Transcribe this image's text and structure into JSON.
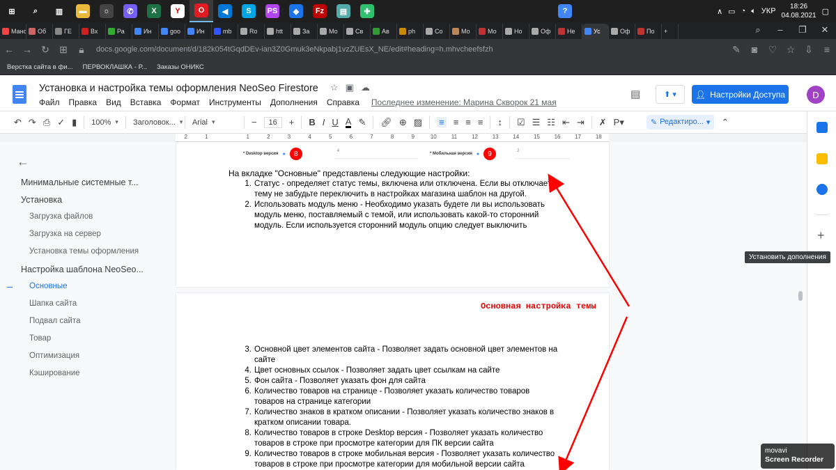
{
  "taskbar": {
    "apps": [
      {
        "name": "windows-start-icon",
        "label": "⊞",
        "color": "#1f1f1f"
      },
      {
        "name": "search-icon",
        "label": "⌕",
        "color": "#1f1f1f"
      },
      {
        "name": "task-view-icon",
        "label": "▥",
        "color": "#1f1f1f"
      },
      {
        "name": "file-explorer-icon",
        "label": "▬",
        "color": "#e8b93a"
      },
      {
        "name": "app-icon",
        "label": "☼",
        "color": "#444"
      },
      {
        "name": "viber-icon",
        "label": "✆",
        "color": "#7360f2"
      },
      {
        "name": "excel-icon",
        "label": "X",
        "color": "#1e7145"
      },
      {
        "name": "yandex-browser-icon",
        "label": "Y",
        "color": "#fff"
      },
      {
        "name": "opera-icon",
        "label": "O",
        "color": "#e01b22"
      },
      {
        "name": "vscode-icon",
        "label": "◀",
        "color": "#0078d7"
      },
      {
        "name": "skype-icon",
        "label": "S",
        "color": "#00a5e4"
      },
      {
        "name": "phpstorm-icon",
        "label": "PS",
        "color": "#b345f1"
      },
      {
        "name": "maps-icon",
        "label": "◆",
        "color": "#1a73e8"
      },
      {
        "name": "filezilla-icon",
        "label": "Fz",
        "color": "#bf0000"
      },
      {
        "name": "notes-icon",
        "label": "▤",
        "color": "#5aa"
      },
      {
        "name": "teamviewer-icon",
        "label": "✚",
        "color": "#2fbf6f"
      },
      {
        "name": "chrome-icon",
        "label": "?",
        "color": "#4285f4"
      }
    ],
    "language": "УКР",
    "time": "18:26",
    "date": "04.08.2021"
  },
  "tabs": [
    {
      "label": "Мано",
      "color": "#e44"
    },
    {
      "label": "Об",
      "color": "#c66"
    },
    {
      "label": "ГЕ",
      "color": "#888"
    },
    {
      "label": "Вх",
      "color": "#c22"
    },
    {
      "label": "Ра",
      "color": "#3a3"
    },
    {
      "label": "Ин",
      "color": "#4285f4"
    },
    {
      "label": "goo",
      "color": "#4285f4"
    },
    {
      "label": "Ин",
      "color": "#4285f4"
    },
    {
      "label": "mb",
      "color": "#35f"
    },
    {
      "label": "Ro",
      "color": "#aaa"
    },
    {
      "label": "htt",
      "color": "#aaa"
    },
    {
      "label": "За",
      "color": "#aaa"
    },
    {
      "label": "Мо",
      "color": "#aaa"
    },
    {
      "label": "Св",
      "color": "#aaa"
    },
    {
      "label": "Ав",
      "color": "#393"
    },
    {
      "label": "ph",
      "color": "#c80"
    },
    {
      "label": "Co",
      "color": "#aaa"
    },
    {
      "label": "Мо",
      "color": "#b85"
    },
    {
      "label": "Мо",
      "color": "#b33"
    },
    {
      "label": "Но",
      "color": "#aaa"
    },
    {
      "label": "Оф",
      "color": "#aaa"
    },
    {
      "label": "Не",
      "color": "#b33"
    },
    {
      "label": "Ус",
      "color": "#4285f4"
    },
    {
      "label": "Оф",
      "color": "#aaa"
    },
    {
      "label": "По",
      "color": "#b33"
    }
  ],
  "active_tab_index": 22,
  "address": {
    "url": "docs.google.com/document/d/182k054tGqdDEv-ian3Z0Gmuk3eNkpabj1vzZUEsX_NE/edit#heading=h.mhvcheefsfzh"
  },
  "bookmarks": [
    "Верстка сайта в фи...",
    "ПЕРВОКЛАШКА - Р...",
    "Заказы ОНИКС"
  ],
  "doc": {
    "title": "Установка и настройка темы оформления NeoSeo Firestore",
    "menus": [
      "Файл",
      "Правка",
      "Вид",
      "Вставка",
      "Формат",
      "Инструменты",
      "Дополнения",
      "Справка"
    ],
    "last_edit": "Последнее изменение: Марина Скворок 21 мая",
    "share_label": "Настройки Доступа",
    "avatar_letter": "D"
  },
  "toolbar": {
    "zoom": "100%",
    "style": "Заголовок...",
    "font": "Arial",
    "font_size": "16",
    "edit_mode": "Редактиро..."
  },
  "ruler": [
    "2",
    "1",
    "",
    "1",
    "2",
    "3",
    "4",
    "5",
    "6",
    "7",
    "8",
    "9",
    "10",
    "11",
    "12",
    "13",
    "14",
    "15",
    "16",
    "17",
    "18"
  ],
  "outline": [
    {
      "label": "Минимальные системные т...",
      "level": 1,
      "selected": false
    },
    {
      "label": "Установка",
      "level": 1,
      "selected": false
    },
    {
      "label": "Загрузка файлов",
      "level": 2,
      "selected": false
    },
    {
      "label": "Загрузка на сервер",
      "level": 2,
      "selected": false
    },
    {
      "label": "Установка темы оформления",
      "level": 2,
      "selected": false
    },
    {
      "label": "Настройка шаблона NeoSeo...",
      "level": 1,
      "selected": false
    },
    {
      "label": "Основные",
      "level": 2,
      "selected": true
    },
    {
      "label": "Шапка сайта",
      "level": 2,
      "selected": false
    },
    {
      "label": "Подвал сайта",
      "level": 2,
      "selected": false
    },
    {
      "label": "Товар",
      "level": 2,
      "selected": false
    },
    {
      "label": "Оптимизация",
      "level": 2,
      "selected": false
    },
    {
      "label": "Кэширование",
      "level": 2,
      "selected": false
    }
  ],
  "page1": {
    "desktop_label": "* Desktop версия",
    "desktop_value": "4",
    "desktop_marker": "8",
    "mobile_label": "* Мобильная версия",
    "mobile_value": "2",
    "mobile_marker": "9",
    "intro": "На вкладке \"Основные\" представлены следующие настройки:",
    "items": [
      {
        "num": "1.",
        "lines": [
          "Статус - определяет статус темы, включена или отключена. Если вы отключаете",
          "тему не забудьте переключить в настройках магазина шаблон на другой."
        ]
      },
      {
        "num": "2.",
        "lines": [
          "Использовать модуль меню - Необходимо указать будете ли вы использовать",
          "модуль меню, поставляемый с темой, или использовать какой-то сторонний",
          "модуль. Если используется сторонний модуль опцию следует выключить"
        ]
      }
    ]
  },
  "page2": {
    "title": "Основная настройка темы",
    "items": [
      {
        "num": "3.",
        "lines": [
          "Основной цвет элементов сайта - Позволяет задать основной цвет элементов на",
          "сайте"
        ]
      },
      {
        "num": "4.",
        "lines": [
          "Цвет основных ссылок - Позволяет задать цвет ссылкам на сайте"
        ]
      },
      {
        "num": "5.",
        "lines": [
          "Фон сайта - Позволяет указать фон для сайта"
        ]
      },
      {
        "num": "6.",
        "lines": [
          "Количество товаров на странице - Позволяет указать количество товаров",
          "товаров на странице категории"
        ]
      },
      {
        "num": "7.",
        "lines": [
          "Количество знаков в кратком описании  - Позволяет указать количество знаков в",
          "кратком описании товара."
        ]
      },
      {
        "num": "8.",
        "lines": [
          "Количество товаров в строке Desktop версия - Позволяет указать количество",
          "товаров в строке при просмотре категории для ПК версии сайта"
        ]
      },
      {
        "num": "9.",
        "lines": [
          "Количество товаров в строке мобильная версия - Позволяет указать количество",
          "товаров в строке при просмотре категории для мобильной версии сайта"
        ]
      }
    ]
  },
  "side_panel": {
    "tooltip": "Установить дополнения"
  },
  "watermark": {
    "brand": "movavi",
    "product": "Screen Recorder"
  }
}
